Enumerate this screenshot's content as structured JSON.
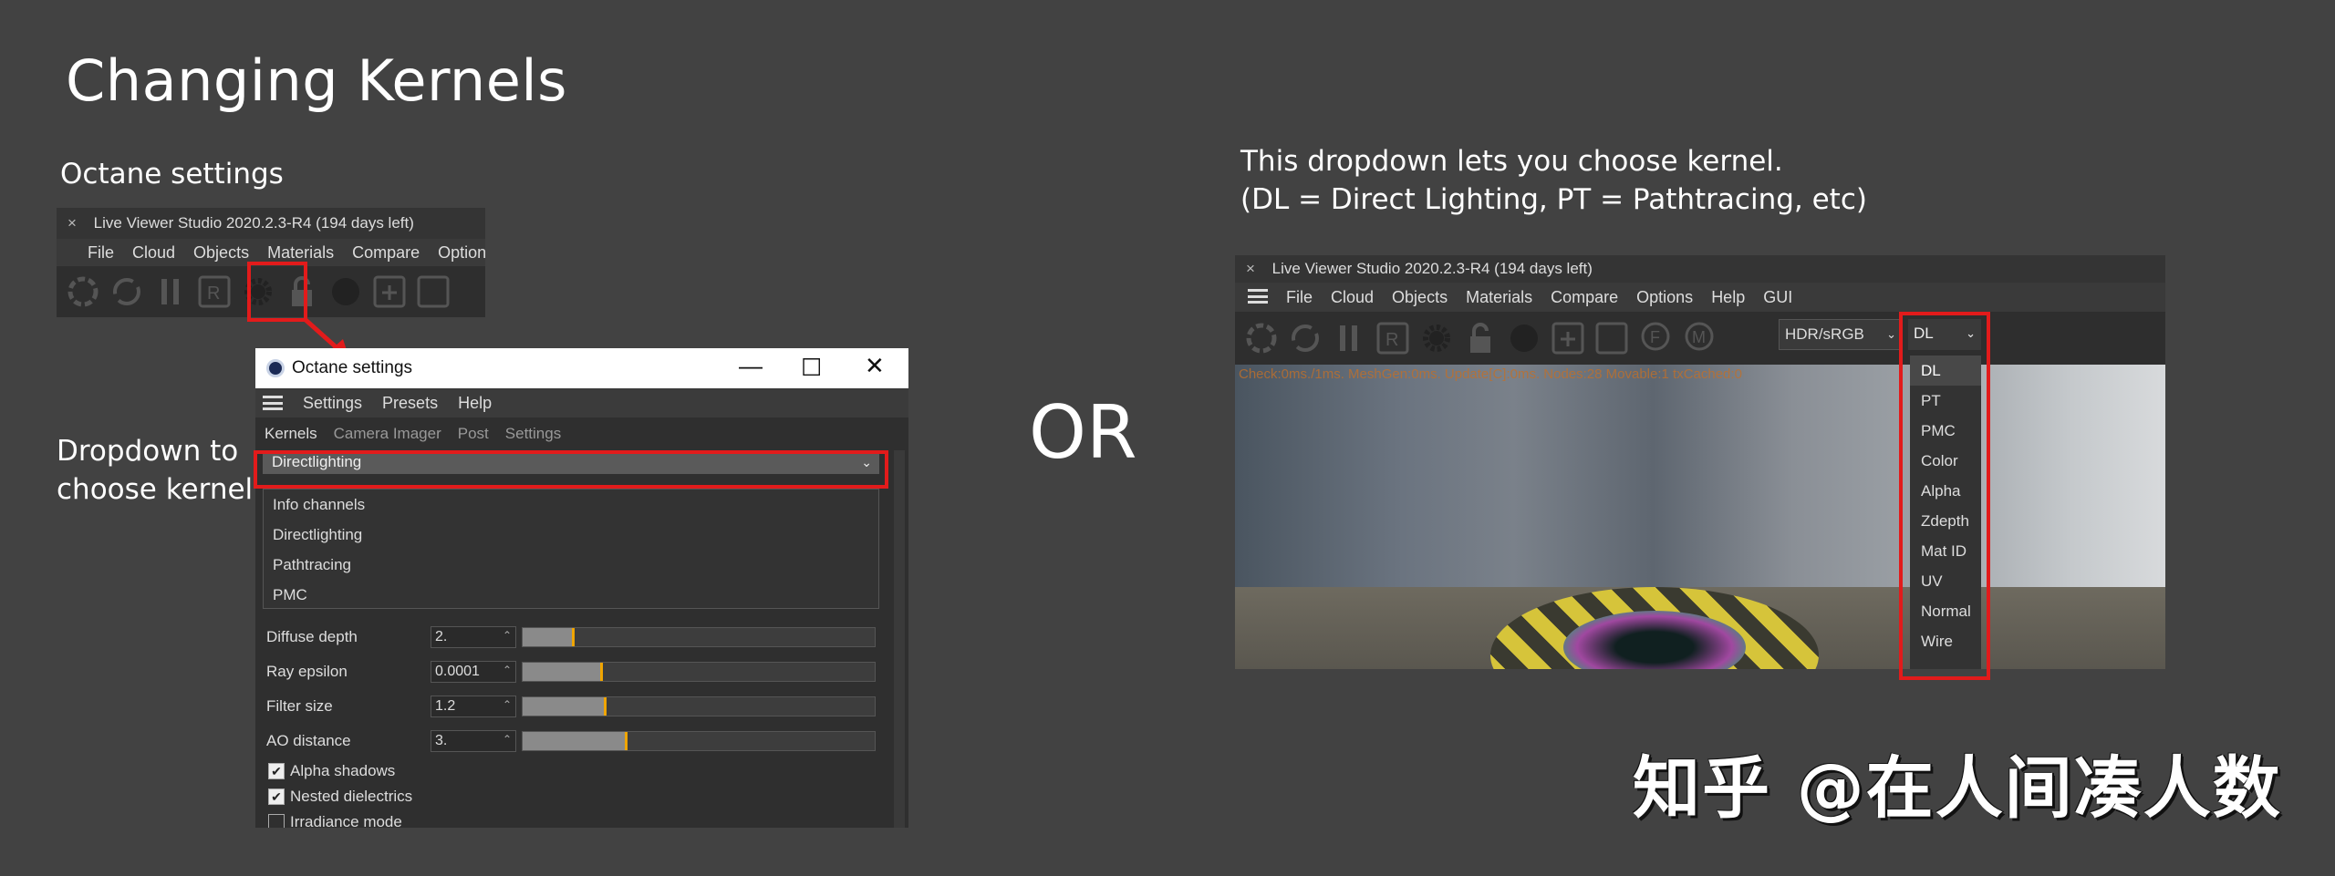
{
  "slide": {
    "title": "Changing Kernels",
    "octane_label": "Octane settings",
    "dropdown_label_line1": "Dropdown to",
    "dropdown_label_line2": "choose kernel",
    "or_label": "OR",
    "desc_line1": "This dropdown lets you choose kernel.",
    "desc_line2": "(DL = Direct Lighting, PT = Pathtracing, etc)",
    "watermark": "知乎 @在人间凑人数"
  },
  "viewer_small": {
    "title": "Live Viewer Studio 2020.2.3-R4 (194 days left)",
    "close": "×",
    "menu": [
      "File",
      "Cloud",
      "Objects",
      "Materials",
      "Compare",
      "Options"
    ]
  },
  "octane_settings": {
    "title": "Octane settings",
    "menu": [
      "Settings",
      "Presets",
      "Help"
    ],
    "tabs": [
      "Kernels",
      "Camera Imager",
      "Post",
      "Settings"
    ],
    "kernel_selected": "Directlighting",
    "kernel_options": [
      "Info channels",
      "Directlighting",
      "Pathtracing",
      "PMC"
    ],
    "params": [
      {
        "label": "Diffuse depth",
        "value": "2.",
        "fill": 0.14
      },
      {
        "label": "Ray epsilon",
        "value": "0.0001",
        "fill": 0.22
      },
      {
        "label": "Filter size",
        "value": "1.2",
        "fill": 0.23
      },
      {
        "label": "AO distance",
        "value": "3.",
        "fill": 0.29
      }
    ],
    "checkboxes": [
      {
        "label": "Alpha shadows",
        "checked": true
      },
      {
        "label": "Nested dielectrics",
        "checked": true
      },
      {
        "label": "Irradiance mode",
        "checked": false
      }
    ]
  },
  "viewer_large": {
    "title": "Live Viewer Studio 2020.2.3-R4 (194 days left)",
    "close": "×",
    "menu": [
      "File",
      "Cloud",
      "Objects",
      "Materials",
      "Compare",
      "Options",
      "Help",
      "GUI"
    ],
    "color_mode": "HDR/sRGB",
    "kernel_selected": "DL",
    "kernel_options": [
      "DL",
      "PT",
      "PMC",
      "Color",
      "Alpha",
      "Zdepth",
      "Mat ID",
      "UV",
      "Normal",
      "Wire"
    ],
    "status": "Check:0ms./1ms. MeshGen:0ms. Update[C]:0ms. Nodes:28 Movable:1 txCached:0"
  },
  "colors": {
    "background": "#424242",
    "highlight_red": "#e21b1b",
    "slider_marker": "#f0a500"
  }
}
